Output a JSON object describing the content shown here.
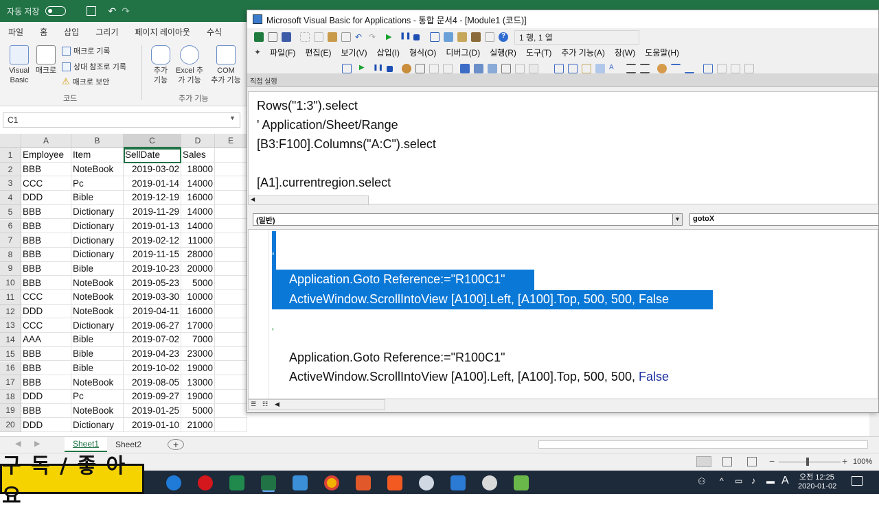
{
  "excel": {
    "autosave_label": "자동 저장",
    "tabs": [
      "파일",
      "홈",
      "삽입",
      "그리기",
      "페이지 레이아웃",
      "수식"
    ],
    "ribbon": {
      "visual_basic": [
        "Visual",
        "Basic"
      ],
      "macro": "매크로",
      "record_macro": "매크로 기록",
      "relative_ref": "상대 참조로 기록",
      "macro_security": "매크로 보안",
      "group_code": "코드",
      "addins": [
        "추가",
        "기능"
      ],
      "excel_addins": [
        "Excel 추",
        "가 기능"
      ],
      "com_addins": [
        "COM",
        "추가 기능"
      ],
      "group_addins": "추가 기능"
    },
    "name_box": "C1",
    "columns": [
      "A",
      "B",
      "C",
      "D",
      "E"
    ],
    "headers": [
      "Employee",
      "Item",
      "SellDate",
      "Sales"
    ],
    "rows": [
      [
        "BBB",
        "NoteBook",
        "2019-03-02",
        "18000"
      ],
      [
        "CCC",
        "Pc",
        "2019-01-14",
        "14000"
      ],
      [
        "DDD",
        "Bible",
        "2019-12-19",
        "16000"
      ],
      [
        "BBB",
        "Dictionary",
        "2019-11-29",
        "14000"
      ],
      [
        "BBB",
        "Dictionary",
        "2019-01-13",
        "14000"
      ],
      [
        "BBB",
        "Dictionary",
        "2019-02-12",
        "11000"
      ],
      [
        "BBB",
        "Dictionary",
        "2019-11-15",
        "28000"
      ],
      [
        "BBB",
        "Bible",
        "2019-10-23",
        "20000"
      ],
      [
        "BBB",
        "NoteBook",
        "2019-05-23",
        "5000"
      ],
      [
        "CCC",
        "NoteBook",
        "2019-03-30",
        "10000"
      ],
      [
        "DDD",
        "NoteBook",
        "2019-04-11",
        "16000"
      ],
      [
        "CCC",
        "Dictionary",
        "2019-06-27",
        "17000"
      ],
      [
        "AAA",
        "Bible",
        "2019-07-02",
        "7000"
      ],
      [
        "BBB",
        "Bible",
        "2019-04-23",
        "23000"
      ],
      [
        "BBB",
        "Bible",
        "2019-10-02",
        "19000"
      ],
      [
        "BBB",
        "NoteBook",
        "2019-08-05",
        "13000"
      ],
      [
        "DDD",
        "Pc",
        "2019-09-27",
        "19000"
      ],
      [
        "BBB",
        "NoteBook",
        "2019-01-25",
        "5000"
      ],
      [
        "DDD",
        "Dictionary",
        "2019-01-10",
        "21000"
      ]
    ],
    "row_numbers": [
      "1",
      "2",
      "3",
      "4",
      "5",
      "6",
      "7",
      "8",
      "9",
      "10",
      "11",
      "12",
      "13",
      "14",
      "15",
      "16",
      "17",
      "18",
      "19",
      "20"
    ],
    "sheets": [
      "Sheet1",
      "Sheet2"
    ],
    "add_sheet": "+",
    "zoom": "100%"
  },
  "vba": {
    "title": "Microsoft Visual Basic for Applications - 통합 문서4 - [Module1 (코드)]",
    "position": "1 행, 1 열",
    "menu": [
      "파일(F)",
      "편집(E)",
      "보기(V)",
      "삽입(I)",
      "형식(O)",
      "디버그(D)",
      "실행(R)",
      "도구(T)",
      "추가 기능(A)",
      "창(W)",
      "도움말(H)"
    ],
    "immediate_title": "직접 실행",
    "immediate_lines": [
      "Rows(\"1:3\").select",
      "' Application/Sheet/Range",
      "[B3:F100].Columns(\"A:C\").select",
      "",
      "[A1].currentregion.select"
    ],
    "object_combo": "(일반)",
    "proc_combo": "gotoX",
    "code_lines": [
      {
        "text": "'",
        "hl": false
      },
      {
        "text": "Application.Goto Reference:=\"R100C1\"",
        "hl": true
      },
      {
        "text": "ActiveWindow.ScrollIntoView [A100].Left, [A100].Top, 500, 500, False",
        "hl": true
      },
      {
        "text": "'",
        "hl": false
      },
      {
        "text": "Application.Goto Reference:=\"R100C1\"",
        "hl": false
      },
      {
        "text": "ActiveWindow.ScrollIntoView [A100].Left, [A100].Top, 500, 500, ",
        "hl": false
      }
    ],
    "keyword_false": "False"
  },
  "overlay": {
    "subscribe": "구 독 / 좋 아 요"
  },
  "taskbar": {
    "time": "오전 12:25",
    "date": "2020-01-02",
    "ime": "A"
  },
  "colors": {
    "excel_green": "#217346",
    "selection_blue": "#0a78d7",
    "taskbar": "#1d2a3a",
    "overlay_yellow": "#f5d300"
  }
}
